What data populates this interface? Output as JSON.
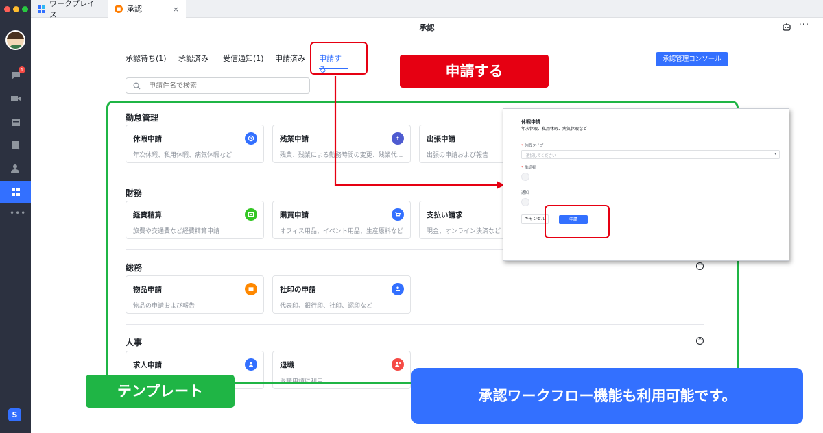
{
  "tabs": [
    {
      "label": "ワークプレイス"
    },
    {
      "label": "承認",
      "close": "×"
    }
  ],
  "window": {
    "title": "承認"
  },
  "rail": {
    "badge": "1",
    "app_letter": "S"
  },
  "nav": {
    "items": [
      "承認待ち(1)",
      "承認済み",
      "受信通知(1)",
      "申請済み",
      "申請する"
    ],
    "active": "申請する"
  },
  "console_button": "承認管理コンソール",
  "search": {
    "placeholder": "申請件名で検索"
  },
  "sections": [
    {
      "title": "勤怠管理",
      "cards": [
        {
          "title": "休暇申請",
          "desc": "年次休暇、私用休暇、病気休暇など",
          "icon": "clock-icon",
          "color": "#3370ff"
        },
        {
          "title": "残業申請",
          "desc": "残業、残業による勤務時間の変更、残業代...",
          "icon": "lamp-icon",
          "color": "#4e5bd0"
        },
        {
          "title": "出張申請",
          "desc": "出張の申請および報告",
          "icon": "plane-icon",
          "color": "#3370ff"
        }
      ]
    },
    {
      "title": "財務",
      "cards": [
        {
          "title": "経費精算",
          "desc": "旅費や交通費など経費精算申請",
          "icon": "money-icon",
          "color": "#34c724"
        },
        {
          "title": "購買申請",
          "desc": "オフィス用品、イベント用品、生産原料など",
          "icon": "cart-icon",
          "color": "#3370ff"
        },
        {
          "title": "支払い請求",
          "desc": "現金、オンライン決済など",
          "icon": "payment-icon",
          "color": "#3370ff"
        }
      ]
    },
    {
      "title": "総務",
      "cards": [
        {
          "title": "物品申請",
          "desc": "物品の申請および報告",
          "icon": "box-icon",
          "color": "#ff8800"
        },
        {
          "title": "社印の申請",
          "desc": "代表印、銀行印、社印、認印など",
          "icon": "stamp-icon",
          "color": "#3370ff"
        }
      ]
    },
    {
      "title": "人事",
      "cards": [
        {
          "title": "求人申請",
          "desc": "",
          "icon": "person-icon",
          "color": "#3370ff"
        },
        {
          "title": "退職",
          "desc": "退職申請に利用",
          "icon": "person-leave-icon",
          "color": "#f54a45"
        }
      ]
    }
  ],
  "preview": {
    "title": "休暇申請",
    "subtitle": "年次休暇、私用休暇、病気休暇など",
    "field_type_label": "休暇タイプ",
    "field_type_placeholder": "選択してください",
    "approver_label": "承認者",
    "notify_label": "通知",
    "cancel": "キャンセル",
    "submit": "申請"
  },
  "annotations": {
    "apply_label": "申請する",
    "template_label": "テンプレート",
    "workflow_label": "承認ワークフロー機能も利用可能です。"
  },
  "colors": {
    "accent": "#3370ff",
    "annotation_red": "#e60012",
    "annotation_green": "#1fb545"
  }
}
